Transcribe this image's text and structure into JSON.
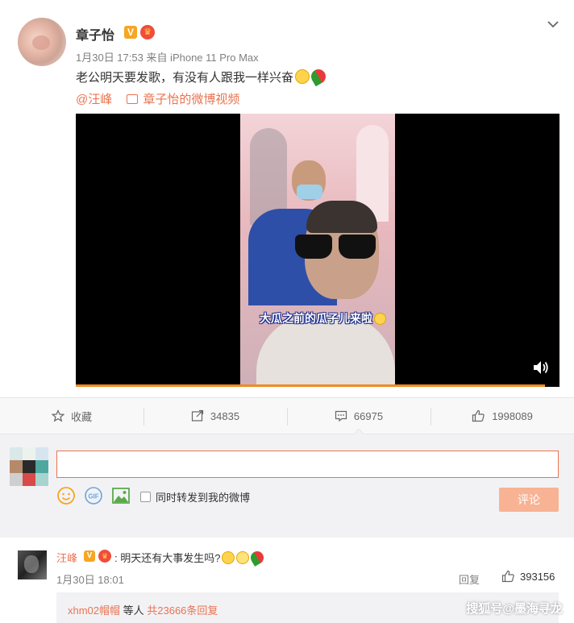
{
  "post": {
    "author": "章子怡",
    "verified_badge": "V",
    "crown_badge": "♛",
    "meta": "1月30日 17:53 来自 iPhone 11 Pro Max",
    "text": "老公明天要发歌，有没有人跟我一样兴奋",
    "mention": "@汪峰",
    "video_link": "章子怡的微博视频",
    "video_caption": "大瓜之前的瓜子儿来啦",
    "video_progress": 0.97
  },
  "actions": {
    "favorite": "收藏",
    "repost_count": "34835",
    "comment_count": "66975",
    "like_count": "1998089"
  },
  "composer": {
    "input_value": "",
    "sync_label": "同时转发到我的微博",
    "submit_label": "评论"
  },
  "comment": {
    "author": "汪峰",
    "verified_badge": "V",
    "crown_badge": "♛",
    "text": ": 明天还有大事发生吗?",
    "time": "1月30日 18:01",
    "reply_label": "回复",
    "like_count": "393156",
    "subreply_user": "xhm02帽帽",
    "subreply_mid": " 等人 ",
    "subreply_count": "共23666条回复"
  },
  "watermark": "搜狐号@墨海寻龙",
  "colors": {
    "accent": "#eb7350",
    "verified": "#f5a623",
    "progress": "#f08a24"
  },
  "icons": [
    "chevron-down-icon",
    "video-icon",
    "star-icon",
    "repost-icon",
    "comment-icon",
    "thumbs-up-icon",
    "emoji-icon",
    "gif-icon",
    "image-icon",
    "volume-icon"
  ]
}
